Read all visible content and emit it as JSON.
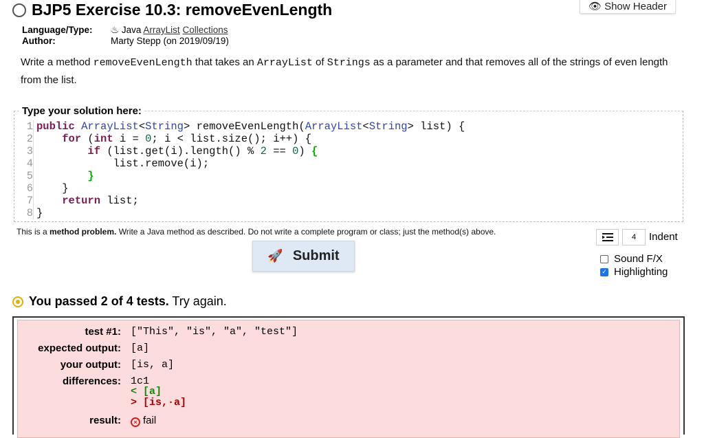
{
  "header": {
    "title": "BJP5 Exercise 10.3: removeEvenLength",
    "show_header_label": "Show Header"
  },
  "meta": {
    "language_label": "Language/Type:",
    "language_prefix": "Java",
    "language_links": [
      "ArrayList",
      "Collections"
    ],
    "author_label": "Author:",
    "author_value": "Marty Stepp (on 2019/09/19)"
  },
  "description": {
    "parts": [
      "Write a method ",
      "removeEvenLength",
      " that takes an ",
      "ArrayList",
      " of ",
      "Strings",
      " as a parameter and that removes all of the strings of even length from the list."
    ]
  },
  "editor": {
    "legend": "Type your solution here:",
    "line_numbers": [
      "1",
      "2",
      "3",
      "4",
      "5",
      "6",
      "7",
      "8"
    ],
    "code_lines": [
      "public ArrayList<String> removeEvenLength(ArrayList<String> list) {",
      "    for (int i = 0; i < list.size(); i++) {",
      "        if (list.get(i).length() % 2 == 0) {",
      "            list.remove(i);",
      "        }",
      "    }",
      "    return list;",
      "}"
    ]
  },
  "note": {
    "prefix": "This is a ",
    "bold": "method problem.",
    "suffix": " Write a Java method as described. Do not write a complete program or class; just the method(s) above."
  },
  "controls": {
    "submit_label": "Submit",
    "indent_value": "4",
    "indent_label": "Indent",
    "sound_label": "Sound F/X",
    "sound_checked": false,
    "highlight_label": "Highlighting",
    "highlight_checked": true
  },
  "result": {
    "bold": "You passed 2 of 4 tests.",
    "suffix": " Try again."
  },
  "test": {
    "rows": [
      {
        "label": "test #1:",
        "value": "[\"This\", \"is\", \"a\", \"test\"]"
      },
      {
        "label": "expected output:",
        "value": "[a]"
      },
      {
        "label": "your output:",
        "value": "[is, a]"
      },
      {
        "label": "differences:",
        "value": "1c1"
      }
    ],
    "diff_expected": "< [a]",
    "diff_actual": "> [is,·a]",
    "result_label": "result:",
    "result_value": "fail"
  },
  "colors": {
    "keyword": "#7a1d4f",
    "type": "#3344aa",
    "test_bg": "#fcdcdc",
    "passed_icon": "#e0b000",
    "fail": "#cc2222"
  }
}
